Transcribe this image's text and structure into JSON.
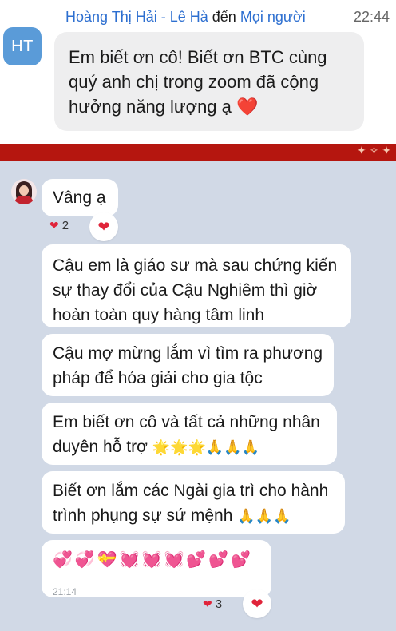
{
  "zoom": {
    "avatar_initials": "HT",
    "sender": "Hoàng Thị Hải - Lê Hà",
    "to_word": "đến",
    "recipient": "Mọi người",
    "time": "22:44",
    "message_lines": [
      "Em biết ơn cô! Biết ơn BTC cùng",
      "quý anh chị trong zoom đã cộng",
      "hưởng năng lượng ạ ❤️"
    ]
  },
  "telegram": {
    "messages": [
      {
        "text": "Vâng ạ",
        "reaction_count": "2"
      },
      {
        "lines": [
          "Cậu em là giáo sư mà sau chứng kiến",
          "sự thay đổi của Cậu Nghiêm thì giờ",
          "hoàn toàn quy hàng tâm linh"
        ]
      },
      {
        "lines": [
          "Cậu mợ mừng lắm vì tìm ra phương",
          "pháp để hóa giải cho gia tộc"
        ]
      },
      {
        "lines": [
          "Em biết ơn cô và tất cả những nhân",
          "duyên hỗ trợ"
        ],
        "emoji": "🌟🌟🌟🙏🙏🙏"
      },
      {
        "lines": [
          "Biết ơn lắm các Ngài gia trì cho hành",
          "trình phụng sự sứ mệnh"
        ],
        "emoji": "🙏🙏🙏"
      },
      {
        "emoji_line": "💞💞💝💓💓💓💕💕💕",
        "time": "21:14",
        "reaction_count": "3"
      }
    ]
  }
}
